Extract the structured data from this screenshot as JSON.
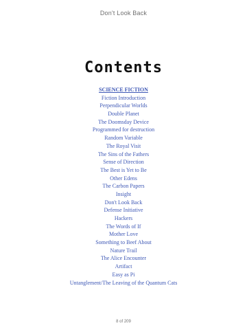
{
  "header": {
    "title": "Don't Look Back"
  },
  "contents": {
    "heading": "Contents",
    "section_label": "SCIENCE FICTION",
    "entries": [
      "Fiction Introduction",
      "Perpendicular Worlds",
      "Double Planet",
      "The Doomsday Device",
      "Programmed for destruction",
      "Random Variable",
      "The Royal Visit",
      "The Sins of the Fathers",
      "Sense of Direction",
      "The Best is Yet to Be",
      "Other Edens",
      "The Carbon Papers",
      "Insight",
      "Don't Look Back",
      "Defense Initiative",
      "Hackers",
      "The Words of If",
      "Mother Love",
      "Something to Beef About",
      "Nature Trail",
      "The Alice Encounter",
      "Artifact",
      "Easy as Pi",
      "Untanglement/The Leaving of the Quantum Cats"
    ]
  },
  "footer": {
    "page_indicator": "8 of 209"
  }
}
